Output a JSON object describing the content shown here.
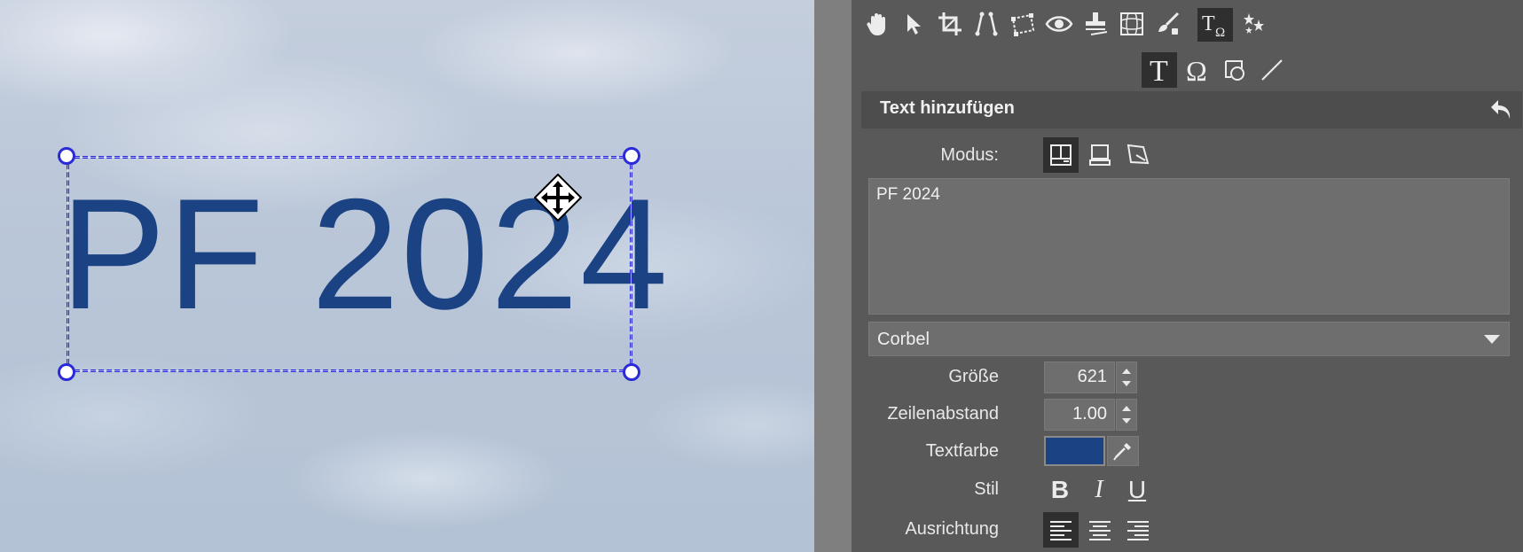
{
  "canvas": {
    "text": "PF 2024",
    "text_color": "#1b4283",
    "frame_color": "#2a2ad8"
  },
  "toolbar": {
    "tools": [
      {
        "name": "hand-icon",
        "active": false
      },
      {
        "name": "pointer-icon",
        "active": false
      },
      {
        "name": "crop-icon",
        "active": false
      },
      {
        "name": "perspective-lines-icon",
        "active": false
      },
      {
        "name": "transform-icon",
        "active": false
      },
      {
        "name": "red-eye-icon",
        "active": false
      },
      {
        "name": "clone-stamp-icon",
        "active": false
      },
      {
        "name": "mesh-warp-icon",
        "active": false
      },
      {
        "name": "brush-icon",
        "active": false
      },
      {
        "name": "text-symbol-icon",
        "active": true
      },
      {
        "name": "stars-effects-icon",
        "active": false
      }
    ],
    "subtools": [
      {
        "name": "text-tool-icon",
        "active": true
      },
      {
        "name": "omega-symbol-icon",
        "active": false
      },
      {
        "name": "shape-icon",
        "active": false
      },
      {
        "name": "line-icon",
        "active": false
      }
    ]
  },
  "panel": {
    "title": "Text hinzufügen",
    "modus_label": "Modus:",
    "modes": [
      "mode-box-icon",
      "mode-bottom-icon",
      "mode-perspective-icon"
    ],
    "text_value": "PF 2024",
    "font": "Corbel",
    "size_label": "Größe",
    "size_value": "621",
    "line_spacing_label": "Zeilenabstand",
    "line_spacing_value": "1.00",
    "color_label": "Textfarbe",
    "color_value": "#1b4283",
    "style_label": "Stil",
    "style_bold": "B",
    "style_italic": "I",
    "style_underline": "U",
    "align_label": "Ausrichtung"
  }
}
